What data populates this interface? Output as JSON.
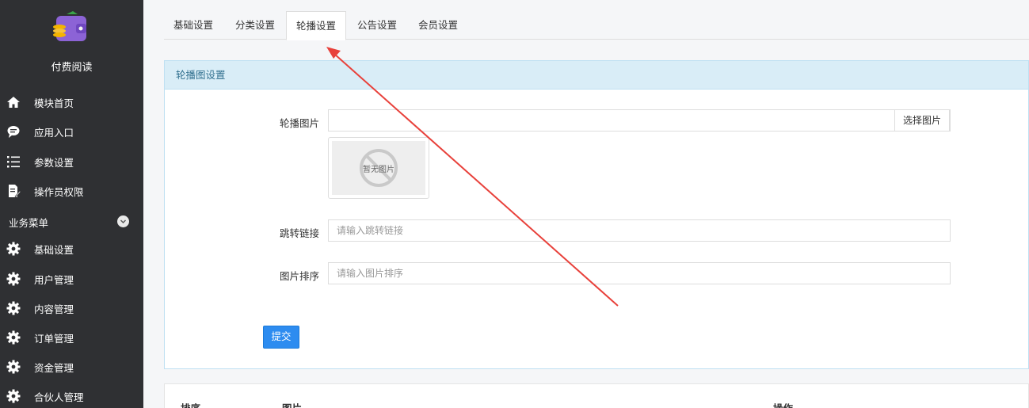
{
  "app": {
    "name": "付费阅读"
  },
  "sidebar": {
    "top_items": [
      {
        "label": "模块首页",
        "icon": "home-icon"
      },
      {
        "label": "应用入口",
        "icon": "chat-bubble-icon"
      },
      {
        "label": "参数设置",
        "icon": "list-icon"
      },
      {
        "label": "操作员权限",
        "icon": "edit-document-icon"
      }
    ],
    "section_title": "业务菜单",
    "section_items": [
      {
        "label": "基础设置",
        "icon": "gear-icon"
      },
      {
        "label": "用户管理",
        "icon": "gear-icon"
      },
      {
        "label": "内容管理",
        "icon": "gear-icon"
      },
      {
        "label": "订单管理",
        "icon": "gear-icon"
      },
      {
        "label": "资金管理",
        "icon": "gear-icon"
      },
      {
        "label": "合伙人管理",
        "icon": "gear-icon"
      }
    ]
  },
  "tabs": [
    {
      "label": "基础设置",
      "active": false
    },
    {
      "label": "分类设置",
      "active": false
    },
    {
      "label": "轮播设置",
      "active": true
    },
    {
      "label": "公告设置",
      "active": false
    },
    {
      "label": "会员设置",
      "active": false
    }
  ],
  "panel": {
    "title": "轮播图设置",
    "image_label": "轮播图片",
    "image_value": "",
    "choose_image": "选择图片",
    "placeholder_image_text": "暂无图片",
    "link_label": "跳转链接",
    "link_placeholder": "请输入跳转链接",
    "sort_label": "图片排序",
    "sort_placeholder": "请输入图片排序",
    "submit": "提交"
  },
  "table": {
    "headers": [
      "排序",
      "图片",
      "操作"
    ]
  },
  "colors": {
    "sidebar_bg": "#2f3033",
    "panel_heading_bg": "#d9edf7",
    "primary_button": "#2d8cf0",
    "annotation_arrow": "#e8413b"
  }
}
